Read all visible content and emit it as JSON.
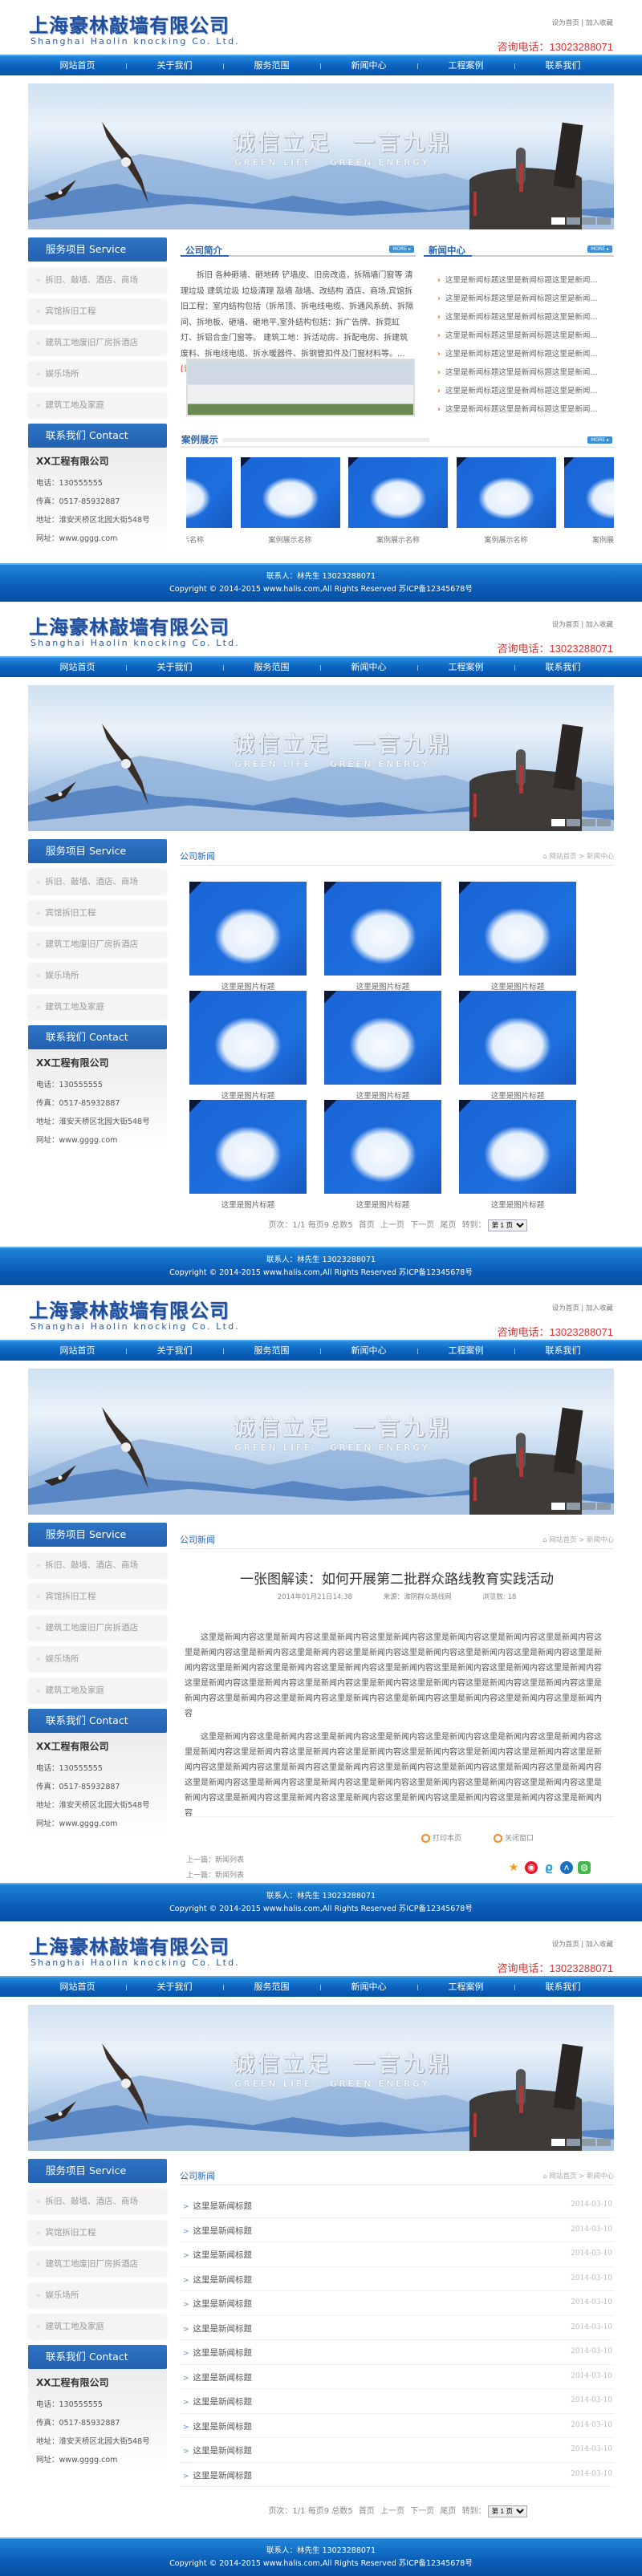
{
  "site": {
    "company_cn": "上海豪林敲墙有限公司",
    "company_en": "Shanghai Haolin knocking Co. Ltd.",
    "top_links": [
      "设为首页",
      "加入收藏"
    ],
    "top_links_sep": "|",
    "hotline": "咨询电话：13023288071",
    "nav": [
      "网站首页",
      "关于我们",
      "服务范围",
      "新闻中心",
      "工程案例",
      "联系我们"
    ],
    "banner": {
      "slogan1": "诚信立足",
      "slogan2": "一言九鼎",
      "sub1": "GREEN LIFE",
      "sub2": "GREEN ENERGY",
      "slides": 4,
      "active_slide": 1
    },
    "sidebar": {
      "service_title": "服务项目 Service",
      "services": [
        "拆旧、敲墙、酒店、商场",
        "宾馆拆旧工程",
        "建筑工地废旧厂房拆酒店",
        "娱乐场所",
        "建筑工地及家庭"
      ],
      "bullet": "»",
      "contact_title": "联系我们 Contact",
      "contact": {
        "company": "XX工程有限公司",
        "phone": "电话：130555555",
        "fax": "传真：0517-85932887",
        "address": "地址：淮安天桥区北园大街548号",
        "website": "网址：www.gggg.com"
      }
    },
    "footer": {
      "contact": "联系人：林先生 13023288071",
      "copyright": "Copyright © 2014-2015 www.halis.com,All Rights Reserved 苏ICP备12345678号"
    },
    "colors": {
      "brand_blue": "#1f4e9c",
      "nav_blue": "#0b62bf",
      "hotline_red": "#e03030",
      "accent_orange": "#e46d28"
    }
  },
  "home": {
    "about_title": "公司简介",
    "about_text": "拆旧 各种砸墙、砸地砖 铲墙皮、旧房改造，拆隔墙门窗等 清理垃圾 建筑垃圾 垃圾清理 敲墙 敲墙、改结构 酒店、商场,宾馆拆旧工程：室内结构包括（拆吊顶、拆电线电缆、拆通风系统、拆隔间、拆地板、砸墙、砸地平,室外结构包括：拆广告牌、拆霓虹灯、拆铝合金门窗等。 建筑工地：拆活动房、拆配电房、拆建筑废料、拆电线电缆、拆水暖器件、拆钢管扣件及门窗材料等。...",
    "detail_link": "[详细]",
    "more": "MORE ▸",
    "news_title": "新闻中心",
    "news": [
      "这里是新闻标题这里是新闻标题这里是新闻...",
      "这里是新闻标题这里是新闻标题这里是新闻...",
      "这里是新闻标题这里是新闻标题这里是新闻...",
      "这里是新闻标题这里是新闻标题这里是新闻...",
      "这里是新闻标题这里是新闻标题这里是新闻...",
      "这里是新闻标题这里是新闻标题这里是新闻...",
      "这里是新闻标题这里是新闻标题这里是新闻...",
      "这里是新闻标题这里是新闻标题这里是新闻..."
    ],
    "cases_title": "案例展示",
    "cases": [
      "案例展示名称",
      "案例展示名称",
      "案例展示名称",
      "案例展示名称",
      "案例展示名称"
    ]
  },
  "inner": {
    "section_title": "公司新闻",
    "breadcrumb": {
      "home": "网站首页",
      "sep": " > ",
      "current": "新闻中心"
    },
    "pagination": {
      "info": "页次：1/1 每页9 总数5",
      "first": "首页",
      "prev": "上一页",
      "next": "下一页",
      "last": "尾页",
      "goto": "转到：",
      "selected": "第 1 页"
    }
  },
  "gallery": {
    "items": [
      "这里是图片标题",
      "这里是图片标题",
      "这里是图片标题",
      "这里是图片标题",
      "这里是图片标题",
      "这里是图片标题",
      "这里是图片标题",
      "这里是图片标题",
      "这里是图片标题"
    ]
  },
  "article": {
    "title": "一张图解读：如何开展第二批群众路线教育实践活动",
    "date": "2014年01月21日14:38",
    "source": "来源：淮阴群众路线网",
    "views": "浏览数: 18",
    "paragraphs": [
      "这里是新闻内容这里是新闻内容这里是新闻内容这里是新闻内容这里是新闻内容这里是新闻内容这里是新闻内容这里是新闻内容这里是新闻内容这里是新闻内容这里是新闻内容这里是新闻内容这里是新闻内容这里是新闻内容这里是新闻内容这里是新闻内容这里是新闻内容这里是新闻内容这里是新闻内容这里是新闻内容这里是新闻内容这里是新闻内容这里是新闻内容这里是新闻内容这里是新闻内容这里是新闻内容这里是新闻内容这里是新闻内容这里是新闻内容这里是新闻内容这里是新闻内容这里是新闻内容这里是新闻内容这里是新闻内容这里是新闻内容这里是新闻内容这里是新闻内容",
      "这里是新闻内容这里是新闻内容这里是新闻内容这里是新闻内容这里是新闻内容这里是新闻内容这里是新闻内容这里是新闻内容这里是新闻内容这里是新闻内容这里是新闻内容这里是新闻内容这里是新闻内容这里是新闻内容这里是新闻内容这里是新闻内容这里是新闻内容这里是新闻内容这里是新闻内容这里是新闻内容这里是新闻内容这里是新闻内容这里是新闻内容这里是新闻内容这里是新闻内容这里是新闻内容这里是新闻内容这里是新闻内容这里是新闻内容这里是新闻内容这里是新闻内容这里是新闻内容这里是新闻内容这里是新闻内容这里是新闻内容这里是新闻内容这里是新闻内容"
    ],
    "print": "打印本页",
    "close": "关闭窗口",
    "prev": "上一篇：新闻列表",
    "next": "上一篇：新闻列表",
    "share_icons": [
      "qzone-icon",
      "weibo-icon",
      "tencent-weibo-icon",
      "renren-icon",
      "wechat-icon"
    ]
  },
  "newslist": {
    "items": [
      {
        "title": "这里是新闻标题",
        "date": "2014-03-10"
      },
      {
        "title": "这里是新闻标题",
        "date": "2014-03-10"
      },
      {
        "title": "这里是新闻标题",
        "date": "2014-03-10"
      },
      {
        "title": "这里是新闻标题",
        "date": "2014-03-10"
      },
      {
        "title": "这里是新闻标题",
        "date": "2014-03-10"
      },
      {
        "title": "这里是新闻标题",
        "date": "2014-03-10"
      },
      {
        "title": "这里是新闻标题",
        "date": "2014-03-10"
      },
      {
        "title": "这里是新闻标题",
        "date": "2014-03-10"
      },
      {
        "title": "这里是新闻标题",
        "date": "2014-03-10"
      },
      {
        "title": "这里是新闻标题",
        "date": "2014-03-10"
      },
      {
        "title": "这里是新闻标题",
        "date": "2014-03-10"
      },
      {
        "title": "这里是新闻标题",
        "date": "2014-03-10"
      }
    ],
    "arrow": ">"
  }
}
